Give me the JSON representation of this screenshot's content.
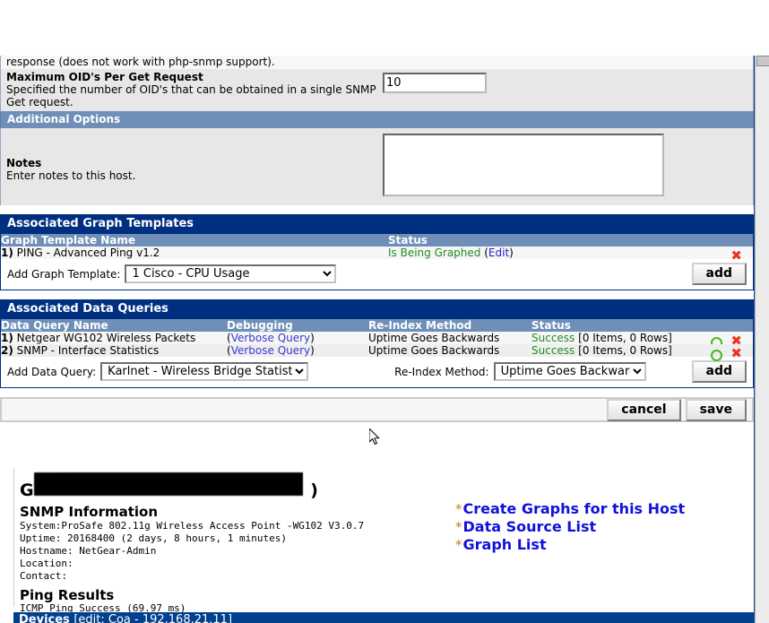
{
  "form": {
    "truncated_top_text": "response (does not work with php-snmp support).",
    "max_oid": {
      "label": "Maximum OID's Per Get Request",
      "description": "Specified the number of OID's that can be obtained in a single SNMP Get request.",
      "value": "10"
    },
    "additional_options_bar": "Additional Options",
    "notes": {
      "label": "Notes",
      "description": "Enter notes to this host.",
      "value": "",
      "placeholder": ""
    }
  },
  "graph_templates": {
    "section_title": "Associated Graph Templates",
    "columns": [
      "Graph Template Name",
      "Status"
    ],
    "rows": [
      {
        "num": "1)",
        "name": "PING - Advanced Ping v1.2",
        "status": "Is Being Graphed",
        "edit_label": "Edit",
        "delete_icon": "red-x-icon"
      }
    ],
    "add_label": "Add Graph Template:",
    "add_selected": "1 Cisco - CPU Usage",
    "add_button": "add"
  },
  "data_queries": {
    "section_title": "Associated Data Queries",
    "columns": [
      "Data Query Name",
      "Debugging",
      "Re-Index Method",
      "Status"
    ],
    "rows": [
      {
        "num": "1)",
        "name": "Netgear WG102 Wireless Packets",
        "debugging": "Verbose Query",
        "reindex": "Uptime Goes Backwards",
        "status_ok": "Success",
        "status_detail": "[0 Items, 0 Rows]",
        "reload_icon": "green-circle-icon",
        "delete_icon": "red-x-icon"
      },
      {
        "num": "2)",
        "name": "SNMP - Interface Statistics",
        "debugging": "Verbose Query",
        "reindex": "Uptime Goes Backwards",
        "status_ok": "Success",
        "status_detail": "[0 Items, 0 Rows]",
        "reload_icon": "green-circle-icon",
        "delete_icon": "red-x-icon"
      }
    ],
    "add_label": "Add Data Query:",
    "add_selected": "Karlnet - Wireless Bridge Statistics",
    "reindex_label": "Re-Index Method:",
    "reindex_selected": "Uptime Goes Backwards",
    "add_button": "add"
  },
  "actions": {
    "cancel": "cancel",
    "save": "save"
  },
  "host_info": {
    "title_prefix": "G",
    "title_suffix": ")",
    "title_redacted": true,
    "snmp_heading": "SNMP Information",
    "snmp_lines": [
      "System:ProSafe 802.11g Wireless Access Point -WG102 V3.0.7",
      "Uptime: 20168400 (2 days, 8 hours, 1 minutes)",
      "Hostname: NetGear-Admin",
      "Location:",
      "Contact:"
    ],
    "ping_heading": "Ping Results",
    "ping_result": "ICMP Ping Success (69.97 ms)"
  },
  "side_links": [
    {
      "star": "*",
      "label": "Create Graphs for this Host"
    },
    {
      "star": "*",
      "label": "Data Source List"
    },
    {
      "star": "*",
      "label": "Graph List"
    }
  ],
  "devices_bar": {
    "label": "Devices",
    "detail": "[edit: Coa - 192.168.21.11]"
  },
  "colors": {
    "section_blue": "#002f80",
    "subheader_blue": "#6f8fb9",
    "success_green": "#228b22",
    "link_blue": "#2222cc",
    "star_orange": "#cc7a1a",
    "delete_red": "#ee3322"
  }
}
